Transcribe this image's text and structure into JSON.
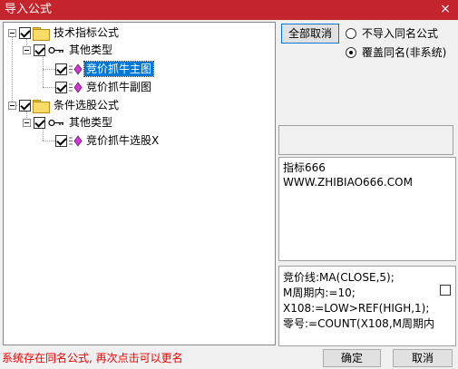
{
  "window": {
    "title": "导入公式",
    "close_glyph": "×"
  },
  "tree": {
    "nodes": [
      {
        "label": "技术指标公式"
      },
      {
        "label": "其他类型"
      },
      {
        "label": "竞价抓牛主图",
        "selected": true
      },
      {
        "label": "竞价抓牛副图"
      },
      {
        "label": "条件选股公式"
      },
      {
        "label": "其他类型"
      },
      {
        "label": "竞价抓牛选股X"
      }
    ]
  },
  "options": {
    "select_all_label": "全部取消",
    "radio_skip_label": "不导入同名公式",
    "radio_overwrite_label": "覆盖同名(非系统)",
    "selected": "overwrite"
  },
  "info": {
    "line1": "指标666",
    "line2": "WWW.ZHIBIAO666.COM"
  },
  "code": {
    "lines": [
      "竞价线:MA(CLOSE,5);",
      "M周期内:=10;",
      "X108:=LOW>REF(HIGH,1);",
      "零号:=COUNT(X108,M周期内"
    ]
  },
  "footer": {
    "status": "系统存在同名公式, 再次点击可以更名",
    "ok_label": "确定",
    "cancel_label": "取消"
  },
  "colors": {
    "titlebar": "#c4242b",
    "selection": "#0078d7",
    "status": "#ee0000"
  }
}
